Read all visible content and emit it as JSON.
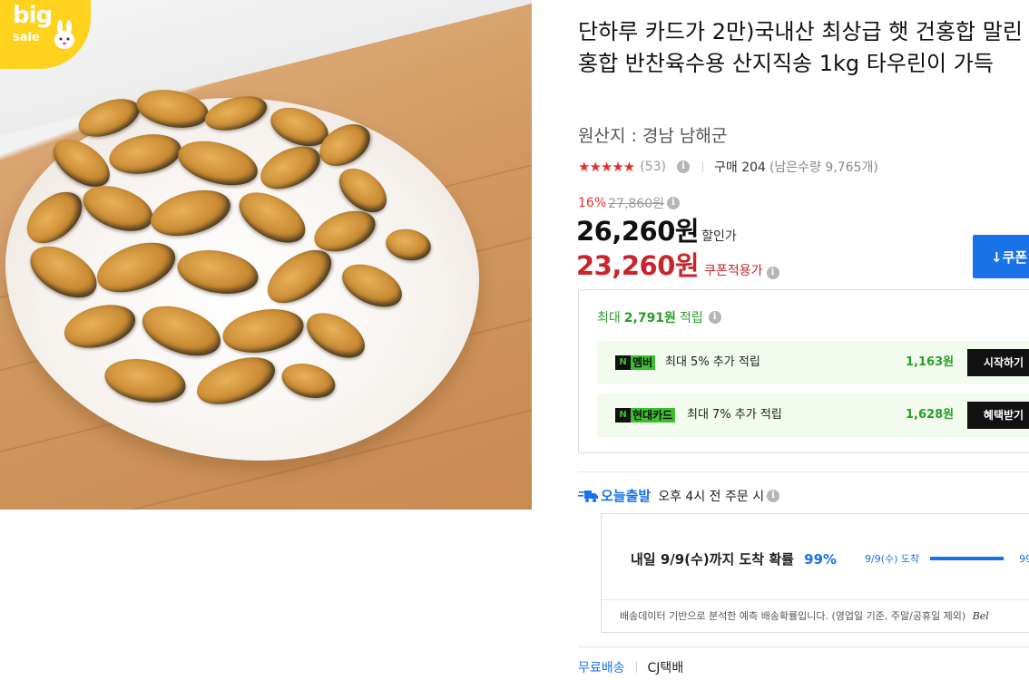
{
  "badge": {
    "big": "big",
    "sale": "sale"
  },
  "product": {
    "title": "단하루 카드가 2만)국내산 최상급 햇 건홍합 말린홍합 반찬육수용 산지직송 1kg 타우린이 가득",
    "origin": "원산지 : 경남 남해군"
  },
  "rating": {
    "stars": "★★★★★",
    "star_value": 5,
    "review_count": "(53)",
    "purchase": "구매 204",
    "remaining": "(남은수량 9,765개)"
  },
  "price": {
    "discount_rate": "16%",
    "original": "27,860원",
    "sale": "26,260원",
    "sale_label": "할인가",
    "coupon": "23,260원",
    "coupon_label": "쿠폰적용가",
    "coupon_button": "↓쿠폰"
  },
  "reward": {
    "prefix": "최대",
    "amount": "2,791원",
    "suffix": "적립",
    "items": [
      {
        "tag": "멤버",
        "desc": "최대 5% 추가 적립",
        "amount": "1,163원",
        "button": "시작하기"
      },
      {
        "tag": "현대카드",
        "desc": "최대 7% 추가 적립",
        "amount": "1,628원",
        "button": "혜택받기"
      }
    ]
  },
  "shipping": {
    "today_label": "오늘출발",
    "text": "오후 4시 전 주문 시",
    "arrival": "내일 9/9(수)까지 도착 확률",
    "arrival_pct": "99%",
    "chart_label": "9/9(수) 도착",
    "chart_value": 0.99,
    "chart_end": "99",
    "note": "배송데이터 기반으로 분석한 예측 배송확률입니다. (영업일 기준, 주말/공휴일 제외)",
    "note_brand": "Bel",
    "free": "무료배송",
    "carrier": "CJ택배"
  },
  "icons": {
    "info": "info-icon",
    "truck": "truck-icon",
    "tag": "naver-n-icon",
    "colors": {
      "blue": "#1a72e8",
      "red": "#c8252c",
      "green": "#2a9d2a",
      "tag_green": "#3dbf2f"
    }
  }
}
